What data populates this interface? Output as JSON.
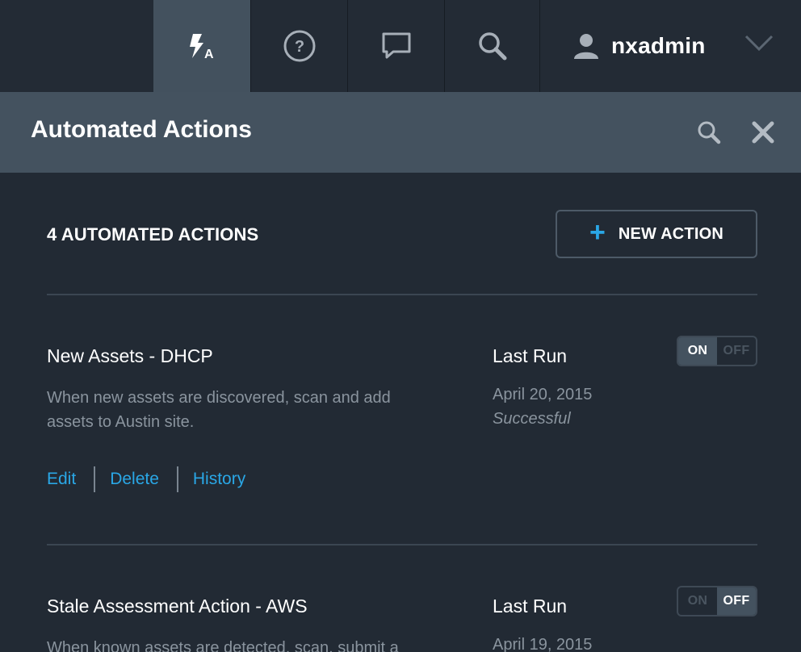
{
  "nav": {
    "tabs": [
      {
        "icon": "automated-actions-icon",
        "active": true
      },
      {
        "icon": "help-icon"
      },
      {
        "icon": "chat-icon"
      },
      {
        "icon": "search-icon"
      }
    ],
    "user": {
      "name": "nxadmin",
      "icon": "user-icon"
    }
  },
  "panel": {
    "title": "Automated Actions"
  },
  "summary": {
    "count_label": "4 AUTOMATED ACTIONS",
    "new_action_label": "NEW ACTION"
  },
  "actions": [
    {
      "name": "New Assets - DHCP",
      "description": "When new assets are discovered, scan and add assets to Austin site.",
      "last_run_label": "Last Run",
      "last_run_date": "April 20, 2015",
      "last_run_status": "Successful",
      "toggle_on": "ON",
      "toggle_off": "OFF",
      "enabled": true,
      "links": {
        "edit": "Edit",
        "delete": "Delete",
        "history": "History"
      }
    },
    {
      "name": "Stale Assessment Action - AWS",
      "description": "When known assets are detected, scan, submit a",
      "last_run_label": "Last Run",
      "last_run_date": "April 19, 2015",
      "toggle_on": "ON",
      "toggle_off": "OFF",
      "enabled": false
    }
  ],
  "colors": {
    "background": "#222a34",
    "header": "#44525f",
    "accent": "#2aa7e6",
    "muted_text": "#8a949e"
  }
}
